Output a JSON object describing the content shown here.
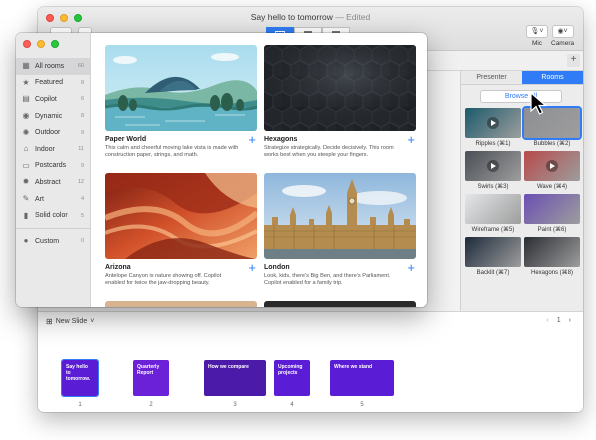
{
  "back_window": {
    "title": "Say hello to tomorrow",
    "edited_label": "— Edited",
    "mic_label": "Mic",
    "camera_label": "Camera",
    "plus_tab": "+"
  },
  "right_panel": {
    "tabs": [
      {
        "label": "Presenter",
        "active": false
      },
      {
        "label": "Rooms",
        "active": true
      }
    ],
    "browse_all": "Browse all",
    "thumbnails": [
      {
        "label": "Ripples (⌘1)",
        "color": "#1b5a6b",
        "play": true
      },
      {
        "label": "Bubbles (⌘2)",
        "color": "#8e8f93",
        "play": false
      },
      {
        "label": "Swirls (⌘3)",
        "color": "#4a4e55",
        "play": true
      },
      {
        "label": "Wave (⌘4)",
        "color": "#b74a4a",
        "play": true
      },
      {
        "label": "Wireframe (⌘5)",
        "color": "#e4e6e8",
        "play": false
      },
      {
        "label": "Paint (⌘6)",
        "color": "#6a4fb3",
        "play": false
      },
      {
        "label": "Backlit (⌘7)",
        "color": "#1d2a3a",
        "play": false
      },
      {
        "label": "Hexagons (⌘8)",
        "color": "#2a2d33",
        "play": false
      }
    ]
  },
  "filmstrip": {
    "new_slide": "New Slide",
    "page_indicator": "1",
    "slides": [
      {
        "num": "1",
        "title": "Say hello to tomorrow.",
        "bg": "#5b1cd6"
      },
      {
        "num": "2",
        "title": "Quarterly Report",
        "bg": "#6b21d8"
      },
      {
        "num": "3",
        "title": "How we compare",
        "bg": "#4c1aa8"
      },
      {
        "num": "4",
        "title": "Upcoming projects",
        "bg": "#5b1cd6"
      },
      {
        "num": "5",
        "title": "Where we stand",
        "bg": "#5b1cd6"
      }
    ]
  },
  "sidebar": {
    "items": [
      {
        "label": "All rooms",
        "count": "60",
        "icon": "grid-icon",
        "glyph": "▦",
        "active": true
      },
      {
        "label": "Featured",
        "count": "8",
        "icon": "star-icon",
        "glyph": "★",
        "active": false
      },
      {
        "label": "Copilot",
        "count": "6",
        "icon": "copilot-icon",
        "glyph": "▤",
        "active": false
      },
      {
        "label": "Dynamic",
        "count": "8",
        "icon": "dynamic-icon",
        "glyph": "◉",
        "active": false
      },
      {
        "label": "Outdoor",
        "count": "9",
        "icon": "sun-icon",
        "glyph": "✺",
        "active": false
      },
      {
        "label": "Indoor",
        "count": "11",
        "icon": "house-icon",
        "glyph": "⌂",
        "active": false
      },
      {
        "label": "Postcards",
        "count": "9",
        "icon": "postcard-icon",
        "glyph": "▭",
        "active": false
      },
      {
        "label": "Abstract",
        "count": "12",
        "icon": "abstract-icon",
        "glyph": "✹",
        "active": false
      },
      {
        "label": "Art",
        "count": "4",
        "icon": "palette-icon",
        "glyph": "✎",
        "active": false
      },
      {
        "label": "Solid color",
        "count": "5",
        "icon": "color-icon",
        "glyph": "▮",
        "active": false
      }
    ],
    "custom": {
      "label": "Custom",
      "count": "0",
      "icon": "person-icon",
      "glyph": "●"
    }
  },
  "cards": [
    {
      "title": "Paper World",
      "desc": "This calm and cheerful moving lake vista is made with construction paper, strings, and math."
    },
    {
      "title": "Hexagons",
      "desc": "Strategize strategically. Decide decisively. This room works best when you steeple your fingers."
    },
    {
      "title": "Arizona",
      "desc": "Antelope Canyon is nature showing off. Copilot enabled for twice the jaw-dropping beauty."
    },
    {
      "title": "London",
      "desc": "Look, kids, there's Big Ben, and there's Parliament. Copilot enabled for a family trip."
    }
  ],
  "plus_glyph": "+"
}
